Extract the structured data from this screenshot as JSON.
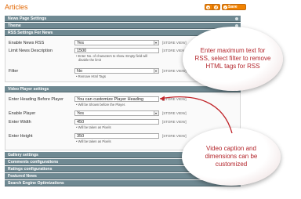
{
  "header": {
    "title": "Articles",
    "back_label": "",
    "reset_label": "",
    "save_label": "Save Config"
  },
  "sections": {
    "news_page_settings": "News  Page Settings",
    "theme": "Theme",
    "rss": "RSS Settings For   News",
    "video_player": "Video Player settings",
    "gallery": "Gallery settings",
    "comments": "Comments configurations",
    "ratings": "Ratings configurations",
    "featured": "Featured   News",
    "seo": "Search Engine Optimizations"
  },
  "rss": {
    "enable_label": "Enable News  RSS",
    "enable_value": "Yes",
    "limit_label": "Limit News  Description",
    "limit_value": "1500",
    "limit_hint_1": "Enter No. of characters to show. Empty field will",
    "limit_hint_2": "disable the limit",
    "filter_label": "Filter",
    "filter_value": "No",
    "filter_hint": "Remove Html Tags",
    "scope": "[STORE VIEW]"
  },
  "video": {
    "heading_label": "Enter Heading Before Player",
    "heading_value": "You can customize Player Heading",
    "heading_hint": "Will be Shown before the Player.",
    "enable_label": "Enable Player",
    "enable_value": "Yes",
    "width_label": "Enter Width",
    "width_value": "450",
    "width_hint": "Will be taken as Pixels",
    "height_label": "Enter Height",
    "height_value": "350",
    "height_hint": "Will be taken as Pixels",
    "scope": "[STORE VIEW]"
  },
  "callouts": {
    "rss": "Enter maximum text for RSS, select filter to remove HTML tags for RSS",
    "video": "Video caption and dimensions can be customized"
  },
  "colors": {
    "accent": "#e26703",
    "section_bar": "#6f8992",
    "callout_text": "#b3242a",
    "arrow": "#c0262b"
  }
}
